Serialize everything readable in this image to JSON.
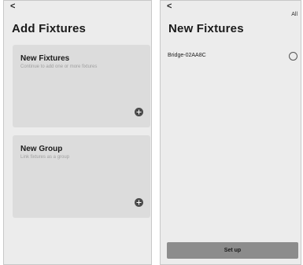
{
  "left_screen": {
    "back_glyph": "<",
    "title": "Add Fixtures",
    "cards": [
      {
        "title": "New Fixtures",
        "subtitle": "Continue to add one or more fixtures",
        "action_icon": "plus-icon"
      },
      {
        "title": "New Group",
        "subtitle": "Link fixtures as a group",
        "action_icon": "plus-icon"
      }
    ]
  },
  "right_screen": {
    "back_glyph": "<",
    "title": "New Fixtures",
    "all_label": "All",
    "devices": [
      {
        "name": "Bridge-02AA8C",
        "selected": false
      }
    ],
    "setup_label": "Set up"
  },
  "colors": {
    "panel_bg": "#ececec",
    "card_bg": "#dcdcdc",
    "button_bg": "#8c8c8c",
    "plus_bg": "#4a4a4a",
    "subtitle_text": "#a0a0a0"
  }
}
